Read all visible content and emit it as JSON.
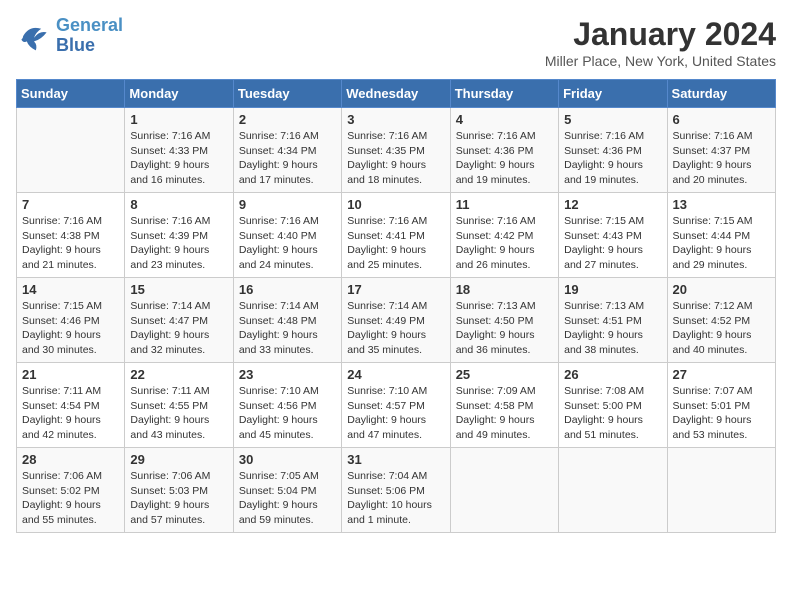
{
  "logo": {
    "text1": "General",
    "text2": "Blue"
  },
  "title": "January 2024",
  "subtitle": "Miller Place, New York, United States",
  "days_of_week": [
    "Sunday",
    "Monday",
    "Tuesday",
    "Wednesday",
    "Thursday",
    "Friday",
    "Saturday"
  ],
  "weeks": [
    [
      {
        "num": "",
        "sunrise": "",
        "sunset": "",
        "daylight": ""
      },
      {
        "num": "1",
        "sunrise": "Sunrise: 7:16 AM",
        "sunset": "Sunset: 4:33 PM",
        "daylight": "Daylight: 9 hours and 16 minutes."
      },
      {
        "num": "2",
        "sunrise": "Sunrise: 7:16 AM",
        "sunset": "Sunset: 4:34 PM",
        "daylight": "Daylight: 9 hours and 17 minutes."
      },
      {
        "num": "3",
        "sunrise": "Sunrise: 7:16 AM",
        "sunset": "Sunset: 4:35 PM",
        "daylight": "Daylight: 9 hours and 18 minutes."
      },
      {
        "num": "4",
        "sunrise": "Sunrise: 7:16 AM",
        "sunset": "Sunset: 4:36 PM",
        "daylight": "Daylight: 9 hours and 19 minutes."
      },
      {
        "num": "5",
        "sunrise": "Sunrise: 7:16 AM",
        "sunset": "Sunset: 4:36 PM",
        "daylight": "Daylight: 9 hours and 19 minutes."
      },
      {
        "num": "6",
        "sunrise": "Sunrise: 7:16 AM",
        "sunset": "Sunset: 4:37 PM",
        "daylight": "Daylight: 9 hours and 20 minutes."
      }
    ],
    [
      {
        "num": "7",
        "sunrise": "Sunrise: 7:16 AM",
        "sunset": "Sunset: 4:38 PM",
        "daylight": "Daylight: 9 hours and 21 minutes."
      },
      {
        "num": "8",
        "sunrise": "Sunrise: 7:16 AM",
        "sunset": "Sunset: 4:39 PM",
        "daylight": "Daylight: 9 hours and 23 minutes."
      },
      {
        "num": "9",
        "sunrise": "Sunrise: 7:16 AM",
        "sunset": "Sunset: 4:40 PM",
        "daylight": "Daylight: 9 hours and 24 minutes."
      },
      {
        "num": "10",
        "sunrise": "Sunrise: 7:16 AM",
        "sunset": "Sunset: 4:41 PM",
        "daylight": "Daylight: 9 hours and 25 minutes."
      },
      {
        "num": "11",
        "sunrise": "Sunrise: 7:16 AM",
        "sunset": "Sunset: 4:42 PM",
        "daylight": "Daylight: 9 hours and 26 minutes."
      },
      {
        "num": "12",
        "sunrise": "Sunrise: 7:15 AM",
        "sunset": "Sunset: 4:43 PM",
        "daylight": "Daylight: 9 hours and 27 minutes."
      },
      {
        "num": "13",
        "sunrise": "Sunrise: 7:15 AM",
        "sunset": "Sunset: 4:44 PM",
        "daylight": "Daylight: 9 hours and 29 minutes."
      }
    ],
    [
      {
        "num": "14",
        "sunrise": "Sunrise: 7:15 AM",
        "sunset": "Sunset: 4:46 PM",
        "daylight": "Daylight: 9 hours and 30 minutes."
      },
      {
        "num": "15",
        "sunrise": "Sunrise: 7:14 AM",
        "sunset": "Sunset: 4:47 PM",
        "daylight": "Daylight: 9 hours and 32 minutes."
      },
      {
        "num": "16",
        "sunrise": "Sunrise: 7:14 AM",
        "sunset": "Sunset: 4:48 PM",
        "daylight": "Daylight: 9 hours and 33 minutes."
      },
      {
        "num": "17",
        "sunrise": "Sunrise: 7:14 AM",
        "sunset": "Sunset: 4:49 PM",
        "daylight": "Daylight: 9 hours and 35 minutes."
      },
      {
        "num": "18",
        "sunrise": "Sunrise: 7:13 AM",
        "sunset": "Sunset: 4:50 PM",
        "daylight": "Daylight: 9 hours and 36 minutes."
      },
      {
        "num": "19",
        "sunrise": "Sunrise: 7:13 AM",
        "sunset": "Sunset: 4:51 PM",
        "daylight": "Daylight: 9 hours and 38 minutes."
      },
      {
        "num": "20",
        "sunrise": "Sunrise: 7:12 AM",
        "sunset": "Sunset: 4:52 PM",
        "daylight": "Daylight: 9 hours and 40 minutes."
      }
    ],
    [
      {
        "num": "21",
        "sunrise": "Sunrise: 7:11 AM",
        "sunset": "Sunset: 4:54 PM",
        "daylight": "Daylight: 9 hours and 42 minutes."
      },
      {
        "num": "22",
        "sunrise": "Sunrise: 7:11 AM",
        "sunset": "Sunset: 4:55 PM",
        "daylight": "Daylight: 9 hours and 43 minutes."
      },
      {
        "num": "23",
        "sunrise": "Sunrise: 7:10 AM",
        "sunset": "Sunset: 4:56 PM",
        "daylight": "Daylight: 9 hours and 45 minutes."
      },
      {
        "num": "24",
        "sunrise": "Sunrise: 7:10 AM",
        "sunset": "Sunset: 4:57 PM",
        "daylight": "Daylight: 9 hours and 47 minutes."
      },
      {
        "num": "25",
        "sunrise": "Sunrise: 7:09 AM",
        "sunset": "Sunset: 4:58 PM",
        "daylight": "Daylight: 9 hours and 49 minutes."
      },
      {
        "num": "26",
        "sunrise": "Sunrise: 7:08 AM",
        "sunset": "Sunset: 5:00 PM",
        "daylight": "Daylight: 9 hours and 51 minutes."
      },
      {
        "num": "27",
        "sunrise": "Sunrise: 7:07 AM",
        "sunset": "Sunset: 5:01 PM",
        "daylight": "Daylight: 9 hours and 53 minutes."
      }
    ],
    [
      {
        "num": "28",
        "sunrise": "Sunrise: 7:06 AM",
        "sunset": "Sunset: 5:02 PM",
        "daylight": "Daylight: 9 hours and 55 minutes."
      },
      {
        "num": "29",
        "sunrise": "Sunrise: 7:06 AM",
        "sunset": "Sunset: 5:03 PM",
        "daylight": "Daylight: 9 hours and 57 minutes."
      },
      {
        "num": "30",
        "sunrise": "Sunrise: 7:05 AM",
        "sunset": "Sunset: 5:04 PM",
        "daylight": "Daylight: 9 hours and 59 minutes."
      },
      {
        "num": "31",
        "sunrise": "Sunrise: 7:04 AM",
        "sunset": "Sunset: 5:06 PM",
        "daylight": "Daylight: 10 hours and 1 minute."
      },
      {
        "num": "",
        "sunrise": "",
        "sunset": "",
        "daylight": ""
      },
      {
        "num": "",
        "sunrise": "",
        "sunset": "",
        "daylight": ""
      },
      {
        "num": "",
        "sunrise": "",
        "sunset": "",
        "daylight": ""
      }
    ]
  ]
}
